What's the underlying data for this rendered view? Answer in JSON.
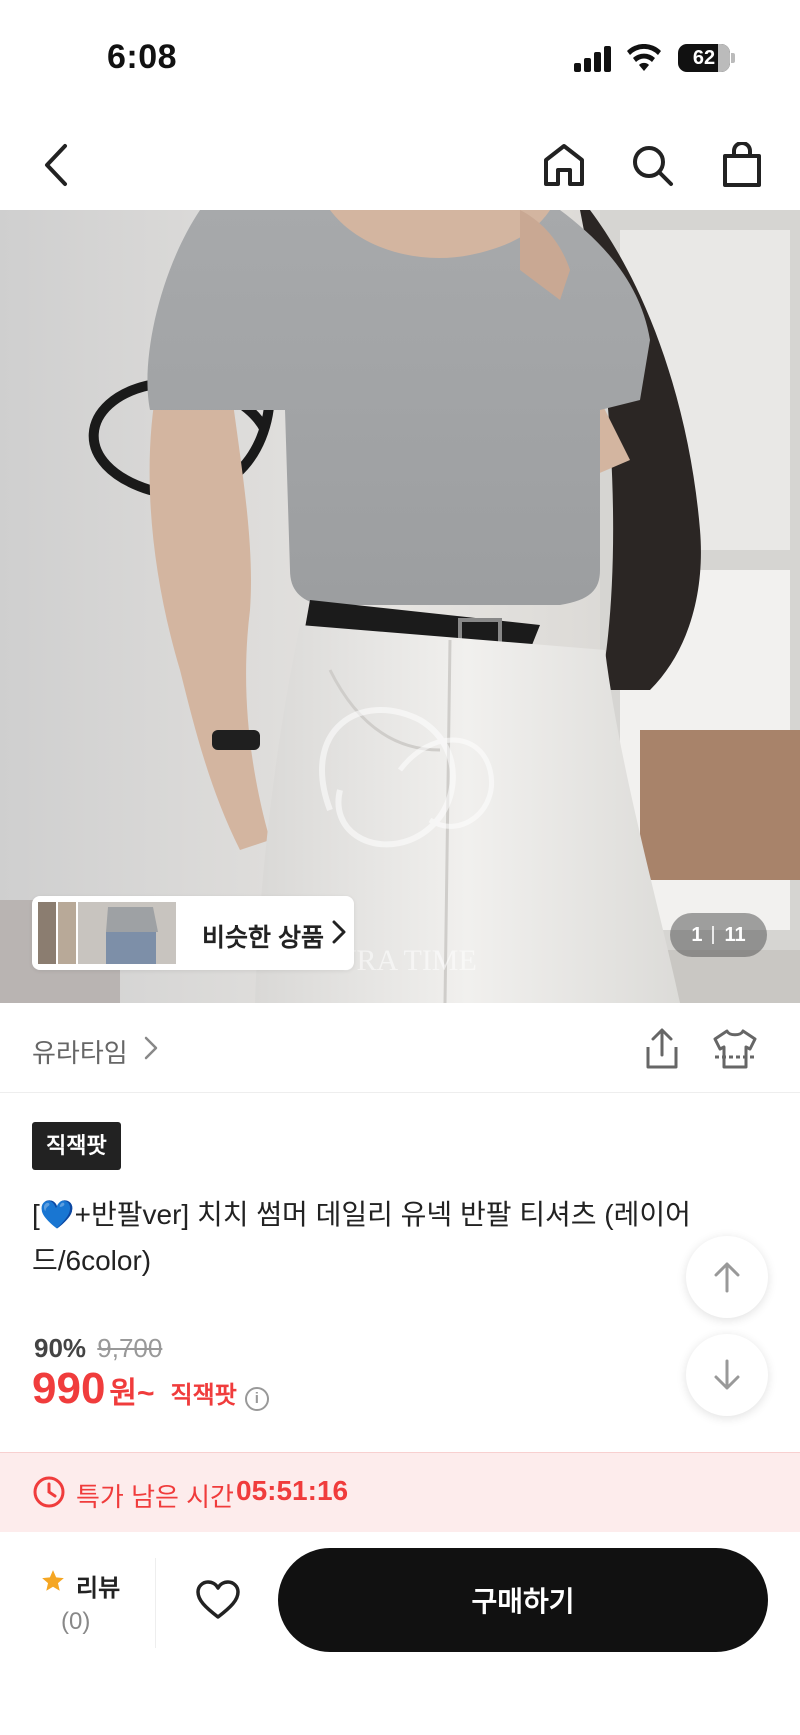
{
  "status_bar": {
    "time": "6:08",
    "battery": "62"
  },
  "nav": {
    "back_icon": "chevron-left-icon",
    "home_icon": "home-icon",
    "search_icon": "search-icon",
    "cart_icon": "shopping-bag-icon"
  },
  "hero": {
    "similar_label": "비슷한 상품",
    "page_current": "1",
    "page_total": "11",
    "watermark": "YURA TIME"
  },
  "store": {
    "name": "유라타임"
  },
  "product": {
    "badge": "직잭팟",
    "title_prefix": "[",
    "title_emoji": "💙",
    "title_text": "+반팔ver] 치치 썸머 데일리 유넥 반팔 티셔츠 (레이어드/6color)",
    "discount": "90%",
    "original_price": "9,700",
    "price": "990",
    "price_unit": "원~",
    "price_tag": "직잭팟",
    "info": "i"
  },
  "timer": {
    "label": "특가 남은 시간",
    "value": "05:51:16"
  },
  "bottom": {
    "review_label": "리뷰",
    "review_count": "(0)",
    "buy_label": "구매하기"
  },
  "colors": {
    "accent_red": "#f03c3c",
    "timer_bg": "#fdecec",
    "button_black": "#111111"
  }
}
